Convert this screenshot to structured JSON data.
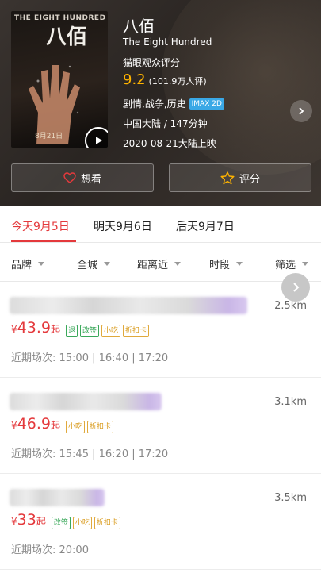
{
  "movie": {
    "poster": {
      "top_text": "THE EIGHT HUNDRED",
      "cn_title": "八佰",
      "date_text": "8月21日"
    },
    "title": "八佰",
    "english_title": "The Eight Hundred",
    "rating_label": "猫眼观众评分",
    "score": "9.2",
    "rating_count": "(101.9万人评)",
    "genres": "剧情,战争,历史",
    "format_badge": "IMAX 2D",
    "region_duration": "中国大陆 / 147分钟",
    "release": "2020-08-21大陆上映",
    "want_label": "想看",
    "rate_label": "评分"
  },
  "date_tabs": [
    {
      "label": "今天9月5日",
      "active": true
    },
    {
      "label": "明天9月6日",
      "active": false
    },
    {
      "label": "后天9月7日",
      "active": false
    }
  ],
  "filters": [
    "品牌",
    "全城",
    "距离近",
    "时段",
    "筛选"
  ],
  "cinemas": [
    {
      "distance": "2.5km",
      "price_symbol": "¥",
      "price": "43.9",
      "price_suffix": "起",
      "tags": [
        "退",
        "改签",
        "小吃",
        "折扣卡"
      ],
      "showtimes": "近期场次: 15:00 | 16:40 | 17:20"
    },
    {
      "distance": "3.1km",
      "price_symbol": "¥",
      "price": "46.9",
      "price_suffix": "起",
      "tags": [
        "小吃",
        "折扣卡"
      ],
      "showtimes": "近期场次: 15:45 | 16:20 | 17:20"
    },
    {
      "distance": "3.5km",
      "price_symbol": "¥",
      "price": "33",
      "price_suffix": "起",
      "tags": [
        "改签",
        "小吃",
        "折扣卡"
      ],
      "showtimes": "近期场次: 20:00"
    }
  ],
  "colors": {
    "accent": "#e4393c",
    "score": "#ffb400",
    "imax_badge": "#3aa8e6",
    "tag_green": "#3aa85a",
    "tag_orange": "#e0a93c"
  }
}
